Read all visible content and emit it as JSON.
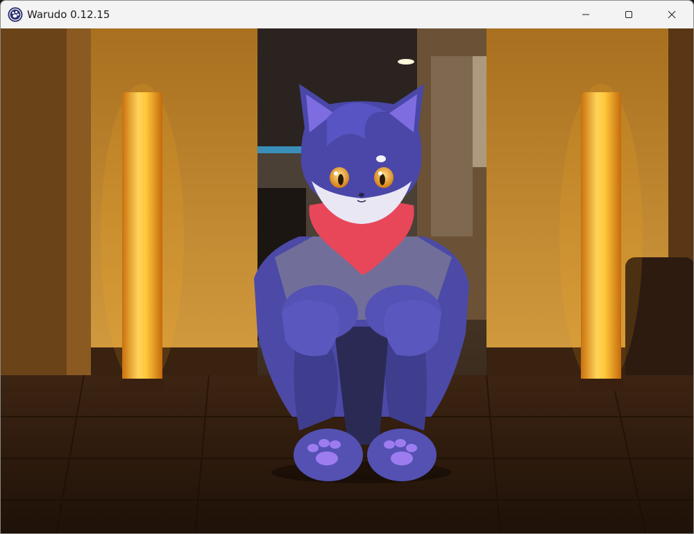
{
  "window": {
    "title": "Warudo 0.12.15",
    "app_icon": "warudo-paw-logo",
    "controls": {
      "minimize_icon": "minimize-icon",
      "maximize_icon": "maximize-icon",
      "close_icon": "close-icon"
    }
  },
  "scene": {
    "description_type": "3d-render-viewport",
    "palette": {
      "lamp_glow": "#ffb020",
      "wall": "#c78a2e",
      "floor": "#3a2412",
      "avatar_fur": "#5a55b8",
      "scarf": "#e8475a",
      "eyes": "#f2a51a"
    }
  }
}
